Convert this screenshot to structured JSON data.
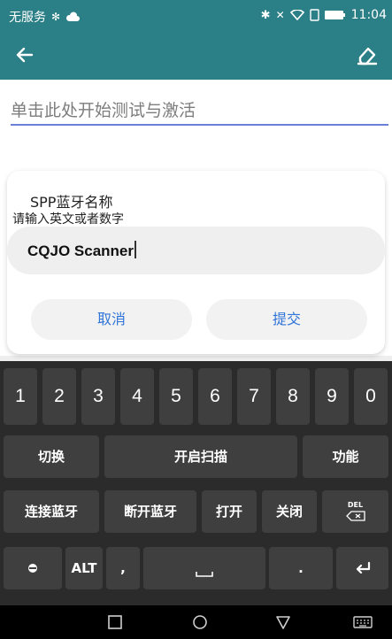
{
  "status_bar": {
    "carrier": "无服务",
    "time": "11:04"
  },
  "activate_text": "单击此处开始测试与激活",
  "dialog": {
    "title": "SPP蓝牙名称",
    "hint": "请输入英文或者数字",
    "input_value": "CQJO Scanner",
    "cancel_label": "取消",
    "submit_label": "提交"
  },
  "keyboard": {
    "number_keys": [
      "1",
      "2",
      "3",
      "4",
      "5",
      "6",
      "7",
      "8",
      "9",
      "0"
    ],
    "row2": {
      "switch": "切换",
      "start_scan": "开启扫描",
      "function": "功能"
    },
    "row3": {
      "connect": "连接蓝牙",
      "disconnect": "断开蓝牙",
      "open": "打开",
      "close": "关闭",
      "del": "DEL"
    },
    "row4": {
      "alt": "ALT",
      "comma": ",",
      "period": "."
    }
  }
}
